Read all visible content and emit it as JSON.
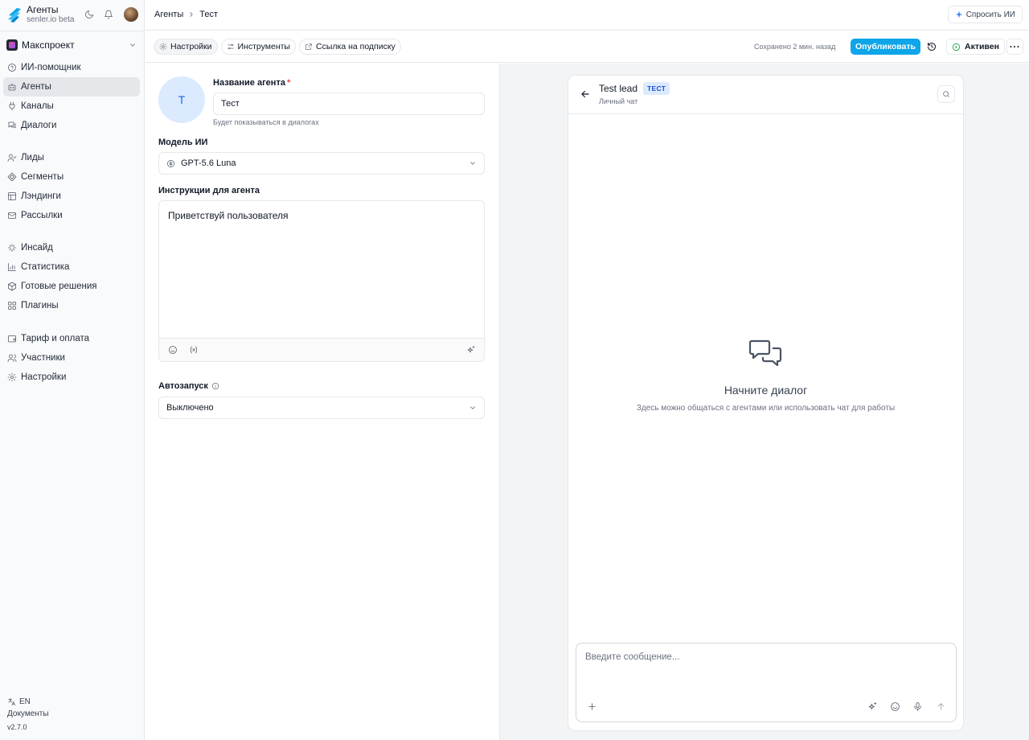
{
  "app": {
    "title": "Агенты",
    "subtitle": "senler.io beta"
  },
  "project": {
    "name": "Макспроект"
  },
  "nav": [
    {
      "label": "ИИ-помощник",
      "icon": "question-circle-icon"
    },
    {
      "label": "Агенты",
      "icon": "bot-icon",
      "active": true
    },
    {
      "label": "Каналы",
      "icon": "plug-icon"
    },
    {
      "label": "Диалоги",
      "icon": "chat-icon"
    },
    {
      "label": "Лиды",
      "icon": "user-check-icon"
    },
    {
      "label": "Сегменты",
      "icon": "segment-icon"
    },
    {
      "label": "Лэндинги",
      "icon": "layout-icon"
    },
    {
      "label": "Рассылки",
      "icon": "mail-icon"
    },
    {
      "label": "Инсайд",
      "icon": "sparkle-icon"
    },
    {
      "label": "Статистика",
      "icon": "bar-chart-icon"
    },
    {
      "label": "Готовые решения",
      "icon": "box-icon"
    },
    {
      "label": "Плагины",
      "icon": "puzzle-icon"
    },
    {
      "label": "Тариф и оплата",
      "icon": "wallet-icon"
    },
    {
      "label": "Участники",
      "icon": "users-icon"
    },
    {
      "label": "Настройки",
      "icon": "gear-icon"
    }
  ],
  "sidebar_footer": {
    "language": "EN",
    "docs": "Документы",
    "version": "v2.7.0"
  },
  "breadcrumb": {
    "parent": "Агенты",
    "separator": ">",
    "current": "Тест"
  },
  "ask_ai_label": "Спросить ИИ",
  "toolbar": {
    "tabs": [
      {
        "label": "Настройки",
        "icon": "gear-icon",
        "active": true
      },
      {
        "label": "Инструменты",
        "icon": "sliders-icon"
      },
      {
        "label": "Ссылка на подписку",
        "icon": "external-link-icon"
      }
    ],
    "saved_text": "Сохранено 2 мин. назад",
    "publish_label": "Опубликовать",
    "status_label": "Активен",
    "more_label": "···"
  },
  "form": {
    "avatar_letter": "Т",
    "name_label": "Название агента",
    "name_required": "*",
    "name_value": "Тест",
    "name_hint": "Будет показываться в диалогах",
    "model_label": "Модель ИИ",
    "model_value": "GPT-5.6 Luna",
    "instructions_label": "Инструкции для агента",
    "instructions_value": "Приветствуй пользователя",
    "autostart_label": "Автозапуск",
    "autostart_value": "Выключено"
  },
  "chat": {
    "title": "Test lead",
    "badge": "ТЕСТ",
    "subtitle": "Личный чат",
    "empty_title": "Начните диалог",
    "empty_subtitle": "Здесь можно общаться с агентами или использовать чат для работы",
    "input_placeholder": "Введите сообщение..."
  },
  "colors": {
    "accent": "#0ea5e9",
    "status_green": "#16a34a",
    "badge_bg": "#dbeafe",
    "avatar_bg": "#dbeafe"
  }
}
